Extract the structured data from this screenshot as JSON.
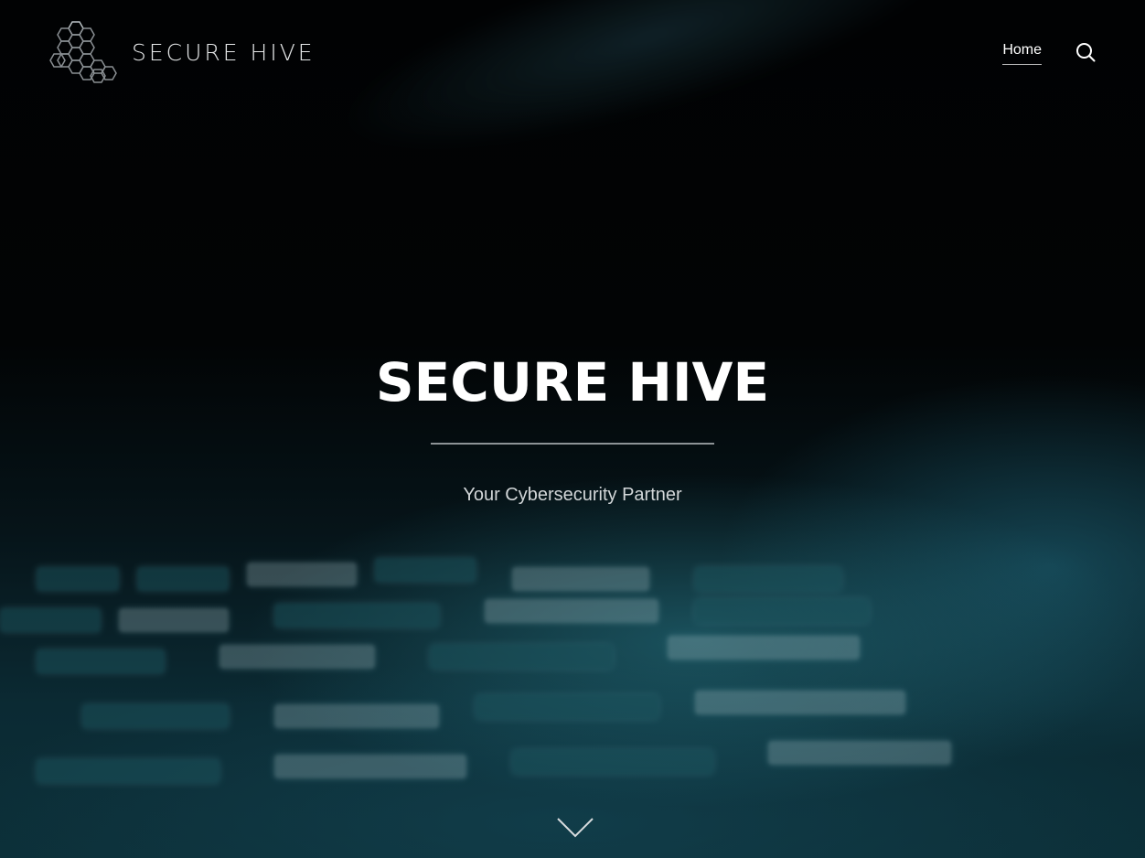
{
  "site": {
    "logo_text": "SECURE HIVE",
    "logo_icon": "hexagon-cluster-icon"
  },
  "nav": {
    "home_label": "Home",
    "search_icon": "search-icon"
  },
  "hero": {
    "title": "SECURE HIVE",
    "subtitle": "Your Cybersecurity Partner",
    "scroll_icon": "chevron-down-icon"
  },
  "colors": {
    "background": "#000000",
    "accent_teal": "#0c2f38",
    "text": "#ffffff"
  }
}
